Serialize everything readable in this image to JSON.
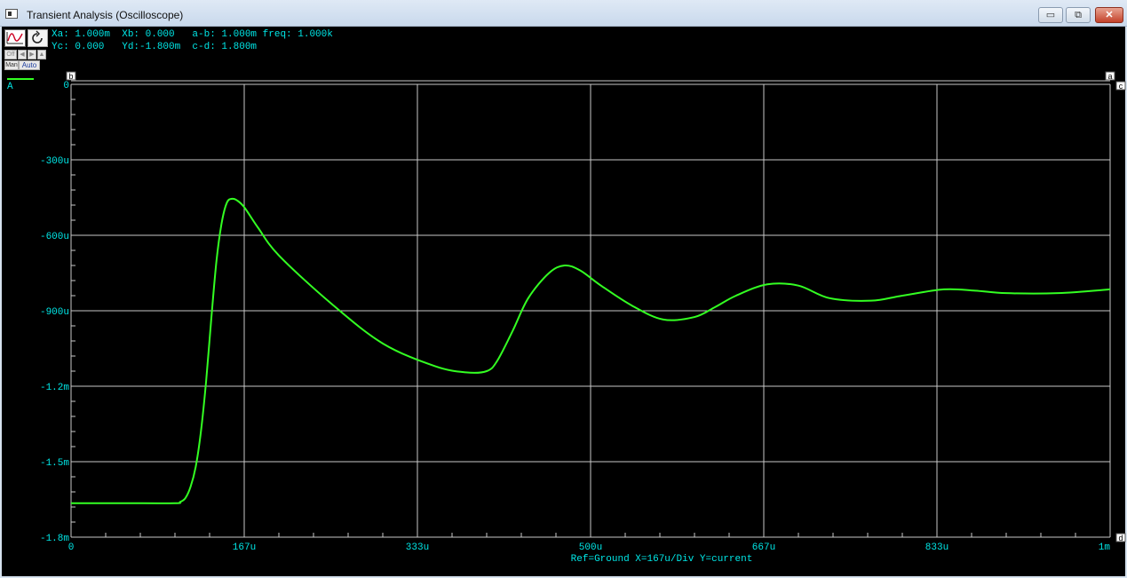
{
  "window": {
    "title": "Transient Analysis (Oscilloscope)",
    "min_label": "▭",
    "max_label": "⧉",
    "close_label": "✕"
  },
  "toolbar": {
    "off_label": "Off",
    "man_label": "Man",
    "auto_label": "Auto"
  },
  "readouts": {
    "row1": "Xa: 1.000m  Xb: 0.000   a-b: 1.000m freq: 1.000k",
    "row2": "Yc: 0.000   Yd:-1.800m  c-d: 1.800m"
  },
  "cursor_markers": {
    "a": "a",
    "b": "b",
    "c": "c",
    "d": "d"
  },
  "footer": "Ref=Ground  X=167u/Div Y=current",
  "colors": {
    "trace": "#33ff22",
    "text": "#00e6e6",
    "grid": "#c8c8c8",
    "background": "#000000"
  },
  "chart_data": {
    "type": "line",
    "legend": [
      {
        "label": "A",
        "color": "#33ff22"
      }
    ],
    "x_ticks": [
      "0",
      "167u",
      "333u",
      "500u",
      "667u",
      "833u",
      "1m"
    ],
    "y_ticks": [
      "0",
      "-300u",
      "-600u",
      "-900u",
      "-1.2m",
      "-1.5m",
      "-1.8m"
    ],
    "xlim": [
      0,
      1.0
    ],
    "ylim": [
      -1.8,
      0
    ],
    "x_unit_note": "x in ms, y in mA",
    "grid": true,
    "series": [
      {
        "color": "#33ff22",
        "x": [
          0,
          0.05,
          0.1,
          0.105,
          0.11,
          0.115,
          0.12,
          0.125,
          0.13,
          0.135,
          0.14,
          0.145,
          0.15,
          0.155,
          0.16,
          0.167,
          0.18,
          0.2,
          0.25,
          0.3,
          0.35,
          0.38,
          0.4,
          0.41,
          0.425,
          0.44,
          0.46,
          0.475,
          0.49,
          0.51,
          0.54,
          0.57,
          0.6,
          0.62,
          0.64,
          0.67,
          0.7,
          0.73,
          0.77,
          0.8,
          0.84,
          0.87,
          0.9,
          0.95,
          1.0
        ],
        "y": [
          -1.665,
          -1.665,
          -1.665,
          -1.66,
          -1.645,
          -1.6,
          -1.52,
          -1.38,
          -1.18,
          -0.93,
          -0.7,
          -0.55,
          -0.47,
          -0.455,
          -0.462,
          -0.49,
          -0.57,
          -0.68,
          -0.87,
          -1.03,
          -1.12,
          -1.145,
          -1.14,
          -1.1,
          -0.98,
          -0.85,
          -0.75,
          -0.72,
          -0.74,
          -0.8,
          -0.88,
          -0.935,
          -0.925,
          -0.885,
          -0.84,
          -0.795,
          -0.8,
          -0.85,
          -0.86,
          -0.84,
          -0.815,
          -0.82,
          -0.83,
          -0.83,
          -0.815
        ]
      }
    ]
  }
}
